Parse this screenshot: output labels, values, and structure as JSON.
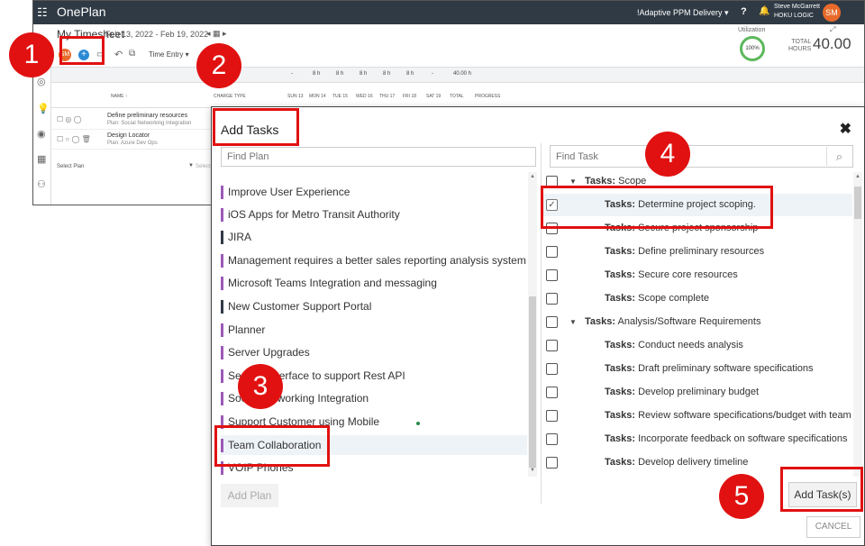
{
  "app": {
    "name": "OnePlan",
    "environment": "!Adaptive PPM Delivery",
    "user_name": "Steve McGarrett",
    "user_org": "HOKU LOGIC",
    "user_initials": "SM",
    "help": "?"
  },
  "timesheet": {
    "title": "My Timesheet",
    "range": "Feb 13, 2022 - Feb 19, 2022",
    "utilization_label": "Utilization",
    "utilization_value": "100%",
    "total_label_1": "TOTAL",
    "total_label_2": "HOURS",
    "total_value": "40.00",
    "toolbar_initials": "SM",
    "time_entry_label": "Time Entry",
    "hours_row": [
      "-",
      "8 h",
      "8 h",
      "8 h",
      "8 h",
      "8 h",
      "-",
      "40.00 h"
    ],
    "columns": [
      "NAME",
      "CHARGE TYPE",
      "SUN 13",
      "MON 14",
      "TUE 15",
      "WED 16",
      "THU 17",
      "FRI 18",
      "SAT 19",
      "TOTAL",
      "PROGRESS"
    ],
    "rows": [
      {
        "name": "Define preliminary resources",
        "plan": "Plan: Social Networking Integration"
      },
      {
        "name": "Design Locator",
        "plan": "Plan: Azure Dev Ops"
      }
    ],
    "select_plan": "Select Plan",
    "select_task": "Select Task"
  },
  "modal": {
    "title": "Add Tasks",
    "find_plan_placeholder": "Find Plan",
    "find_task_placeholder": "Find Task",
    "plans": [
      {
        "label": "Improve User Experience",
        "color": "#9b59b6"
      },
      {
        "label": "iOS Apps for Metro Transit Authority",
        "color": "#9b59b6"
      },
      {
        "label": "JIRA",
        "color": "#2f3a45"
      },
      {
        "label": "Management requires a better sales reporting analysis system",
        "color": "#9b59b6"
      },
      {
        "label": "Microsoft Teams Integration and messaging",
        "color": "#9b59b6"
      },
      {
        "label": "New Customer Support Portal",
        "color": "#2f3a45"
      },
      {
        "label": "Planner",
        "color": "#9b59b6"
      },
      {
        "label": "Server Upgrades",
        "color": "#9b59b6"
      },
      {
        "label": "Service Interface to support Rest API",
        "color": "#9b59b6"
      },
      {
        "label": "Social Networking Integration",
        "color": "#9b59b6"
      },
      {
        "label": "Support Customer using Mobile",
        "color": "#9b59b6"
      },
      {
        "label": "Team Collaboration",
        "color": "#9b59b6"
      },
      {
        "label": "VOIP Phones",
        "color": "#9b59b6"
      }
    ],
    "add_plan_label": "Add Plan",
    "tasks": [
      {
        "prefix": "Tasks:",
        "name": "Scope",
        "group": true,
        "checked": false
      },
      {
        "prefix": "Tasks:",
        "name": "Determine project scoping.",
        "group": false,
        "checked": true
      },
      {
        "prefix": "Tasks:",
        "name": "Secure project sponsorship",
        "group": false,
        "checked": false
      },
      {
        "prefix": "Tasks:",
        "name": "Define preliminary resources",
        "group": false,
        "checked": false
      },
      {
        "prefix": "Tasks:",
        "name": "Secure core resources",
        "group": false,
        "checked": false
      },
      {
        "prefix": "Tasks:",
        "name": "Scope complete",
        "group": false,
        "checked": false
      },
      {
        "prefix": "Tasks:",
        "name": "Analysis/Software Requirements",
        "group": true,
        "checked": false
      },
      {
        "prefix": "Tasks:",
        "name": "Conduct needs analysis",
        "group": false,
        "checked": false
      },
      {
        "prefix": "Tasks:",
        "name": "Draft preliminary software specifications",
        "group": false,
        "checked": false
      },
      {
        "prefix": "Tasks:",
        "name": "Develop preliminary budget",
        "group": false,
        "checked": false
      },
      {
        "prefix": "Tasks:",
        "name": "Review software specifications/budget with team",
        "group": false,
        "checked": false
      },
      {
        "prefix": "Tasks:",
        "name": "Incorporate feedback on software specifications",
        "group": false,
        "checked": false
      },
      {
        "prefix": "Tasks:",
        "name": "Develop delivery timeline",
        "group": false,
        "checked": false
      }
    ],
    "add_tasks_label": "Add Task(s)",
    "cancel_label": "CANCEL",
    "close_symbol": "✖"
  },
  "annotations": {
    "steps": [
      "1",
      "2",
      "3",
      "4",
      "5"
    ],
    "color": "#e11111"
  }
}
